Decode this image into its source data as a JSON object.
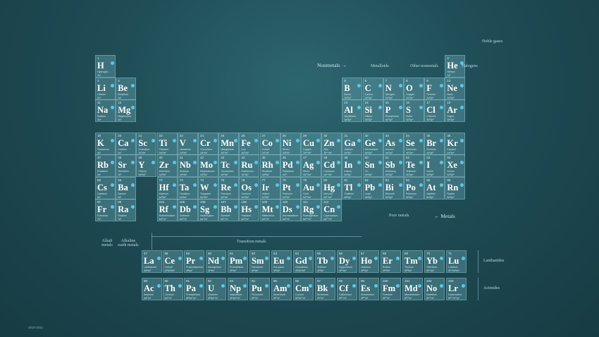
{
  "colors": {
    "background": "#1f4c55",
    "cell": "#6eafbe",
    "dot": "#5bc8e6"
  },
  "labels": {
    "noble_gases": "Noble gases",
    "nonmetals": "Nonmetals →",
    "metalloids": "Metalloids",
    "other_nonmetals": "Other nonmetals",
    "halogens": "Halogens",
    "alkali": "Alkali metals",
    "alkaline": "Alkaline earth metals",
    "transition": "Transition metals",
    "poor": "Poor metals",
    "metals": "← Metals",
    "lanthanides": "Lanthanides",
    "actinides": "Actinides"
  },
  "credit": "2010-2011",
  "elements": [
    {
      "n": "1",
      "s": "H",
      "name": "Hydrogen",
      "c": "1s¹",
      "col": 1,
      "row": 1
    },
    {
      "n": "2",
      "s": "He",
      "name": "Helium",
      "c": "1s²",
      "col": 18,
      "row": 1
    },
    {
      "n": "3",
      "s": "Li",
      "name": "Lithium",
      "c": "2s¹",
      "col": 1,
      "row": 2
    },
    {
      "n": "4",
      "s": "Be",
      "name": "Beryllium",
      "c": "2s²",
      "col": 2,
      "row": 2
    },
    {
      "n": "5",
      "s": "B",
      "name": "Boron",
      "c": "2s²2p¹",
      "col": 13,
      "row": 2
    },
    {
      "n": "6",
      "s": "C",
      "name": "Carbon",
      "c": "2s²2p²",
      "col": 14,
      "row": 2
    },
    {
      "n": "7",
      "s": "N",
      "name": "Nitrogen",
      "c": "2s²2p³",
      "col": 15,
      "row": 2
    },
    {
      "n": "8",
      "s": "O",
      "name": "Oxygen",
      "c": "2s²2p⁴",
      "col": 16,
      "row": 2
    },
    {
      "n": "9",
      "s": "F",
      "name": "Fluorine",
      "c": "2s²2p⁵",
      "col": 17,
      "row": 2
    },
    {
      "n": "10",
      "s": "Ne",
      "name": "Neon",
      "c": "2s²2p⁶",
      "col": 18,
      "row": 2
    },
    {
      "n": "11",
      "s": "Na",
      "name": "Sodium",
      "c": "3s¹",
      "col": 1,
      "row": 3
    },
    {
      "n": "12",
      "s": "Mg",
      "name": "Magnesium",
      "c": "3s²",
      "col": 2,
      "row": 3
    },
    {
      "n": "13",
      "s": "Al",
      "name": "Aluminium",
      "c": "3s²3p¹",
      "col": 13,
      "row": 3
    },
    {
      "n": "14",
      "s": "Si",
      "name": "Silicon",
      "c": "3s²3p²",
      "col": 14,
      "row": 3
    },
    {
      "n": "15",
      "s": "P",
      "name": "Phosphorus",
      "c": "3s²3p³",
      "col": 15,
      "row": 3
    },
    {
      "n": "16",
      "s": "S",
      "name": "Sulfur",
      "c": "3s²3p⁴",
      "col": 16,
      "row": 3
    },
    {
      "n": "17",
      "s": "Cl",
      "name": "Chlorine",
      "c": "3s²3p⁵",
      "col": 17,
      "row": 3
    },
    {
      "n": "18",
      "s": "Ar",
      "name": "Argon",
      "c": "3s²3p⁶",
      "col": 18,
      "row": 3
    },
    {
      "n": "19",
      "s": "K",
      "name": "Potassium",
      "c": "4s¹",
      "col": 1,
      "row": 4
    },
    {
      "n": "20",
      "s": "Ca",
      "name": "Calcium",
      "c": "4s²",
      "col": 2,
      "row": 4
    },
    {
      "n": "21",
      "s": "Sc",
      "name": "Scandium",
      "c": "3d¹4s²",
      "col": 3,
      "row": 4
    },
    {
      "n": "22",
      "s": "Ti",
      "name": "Titanium",
      "c": "3d²4s²",
      "col": 4,
      "row": 4
    },
    {
      "n": "23",
      "s": "V",
      "name": "Vanadium",
      "c": "3d³4s²",
      "col": 5,
      "row": 4
    },
    {
      "n": "24",
      "s": "Cr",
      "name": "Chromium",
      "c": "3d⁵4s¹",
      "col": 6,
      "row": 4
    },
    {
      "n": "25",
      "s": "Mn",
      "name": "Manganese",
      "c": "3d⁵4s²",
      "col": 7,
      "row": 4
    },
    {
      "n": "26",
      "s": "Fe",
      "name": "Iron",
      "c": "3d⁶4s²",
      "col": 8,
      "row": 4
    },
    {
      "n": "27",
      "s": "Co",
      "name": "Cobalt",
      "c": "3d⁷4s²",
      "col": 9,
      "row": 4
    },
    {
      "n": "28",
      "s": "Ni",
      "name": "Nickel",
      "c": "3d⁸4s²",
      "col": 10,
      "row": 4
    },
    {
      "n": "29",
      "s": "Cu",
      "name": "Copper",
      "c": "3d¹⁰4s¹",
      "col": 11,
      "row": 4
    },
    {
      "n": "30",
      "s": "Zn",
      "name": "Zinc",
      "c": "3d¹⁰4s²",
      "col": 12,
      "row": 4
    },
    {
      "n": "31",
      "s": "Ga",
      "name": "Gallium",
      "c": "4s²4p¹",
      "col": 13,
      "row": 4
    },
    {
      "n": "32",
      "s": "Ge",
      "name": "Germanium",
      "c": "4s²4p²",
      "col": 14,
      "row": 4
    },
    {
      "n": "33",
      "s": "As",
      "name": "Arsenic",
      "c": "4s²4p³",
      "col": 15,
      "row": 4
    },
    {
      "n": "34",
      "s": "Se",
      "name": "Selenium",
      "c": "4s²4p⁴",
      "col": 16,
      "row": 4
    },
    {
      "n": "35",
      "s": "Br",
      "name": "Bromine",
      "c": "4s²4p⁵",
      "col": 17,
      "row": 4
    },
    {
      "n": "36",
      "s": "Kr",
      "name": "Krypton",
      "c": "4s²4p⁶",
      "col": 18,
      "row": 4
    },
    {
      "n": "37",
      "s": "Rb",
      "name": "Rubidium",
      "c": "5s¹",
      "col": 1,
      "row": 5
    },
    {
      "n": "38",
      "s": "Sr",
      "name": "Strontium",
      "c": "5s²",
      "col": 2,
      "row": 5
    },
    {
      "n": "39",
      "s": "Y",
      "name": "Yttrium",
      "c": "4d¹5s²",
      "col": 3,
      "row": 5
    },
    {
      "n": "40",
      "s": "Zr",
      "name": "Zirconium",
      "c": "4d²5s²",
      "col": 4,
      "row": 5
    },
    {
      "n": "41",
      "s": "Nb",
      "name": "Niobium",
      "c": "4d⁴5s¹",
      "col": 5,
      "row": 5
    },
    {
      "n": "42",
      "s": "Mo",
      "name": "Molybdenum",
      "c": "4d⁵5s¹",
      "col": 6,
      "row": 5
    },
    {
      "n": "43",
      "s": "Tc",
      "name": "Technetium",
      "c": "4d⁵5s²",
      "col": 7,
      "row": 5
    },
    {
      "n": "44",
      "s": "Ru",
      "name": "Ruthenium",
      "c": "4d⁷5s¹",
      "col": 8,
      "row": 5
    },
    {
      "n": "45",
      "s": "Rh",
      "name": "Rhodium",
      "c": "4d⁸5s¹",
      "col": 9,
      "row": 5
    },
    {
      "n": "46",
      "s": "Pd",
      "name": "Palladium",
      "c": "4d¹⁰",
      "col": 10,
      "row": 5
    },
    {
      "n": "47",
      "s": "Ag",
      "name": "Silver",
      "c": "4d¹⁰5s¹",
      "col": 11,
      "row": 5
    },
    {
      "n": "48",
      "s": "Cd",
      "name": "Cadmium",
      "c": "4d¹⁰5s²",
      "col": 12,
      "row": 5
    },
    {
      "n": "49",
      "s": "In",
      "name": "Indium",
      "c": "5s²5p¹",
      "col": 13,
      "row": 5
    },
    {
      "n": "50",
      "s": "Sn",
      "name": "Tin",
      "c": "5s²5p²",
      "col": 14,
      "row": 5
    },
    {
      "n": "51",
      "s": "Sb",
      "name": "Antimony",
      "c": "5s²5p³",
      "col": 15,
      "row": 5
    },
    {
      "n": "52",
      "s": "Te",
      "name": "Tellurium",
      "c": "5s²5p⁴",
      "col": 16,
      "row": 5
    },
    {
      "n": "53",
      "s": "I",
      "name": "Iodine",
      "c": "5s²5p⁵",
      "col": 17,
      "row": 5
    },
    {
      "n": "54",
      "s": "Xe",
      "name": "Xenon",
      "c": "5s²5p⁶",
      "col": 18,
      "row": 5
    },
    {
      "n": "55",
      "s": "Cs",
      "name": "Caesium",
      "c": "6s¹",
      "col": 1,
      "row": 6
    },
    {
      "n": "56",
      "s": "Ba",
      "name": "Barium",
      "c": "6s²",
      "col": 2,
      "row": 6
    },
    {
      "n": "72",
      "s": "Hf",
      "name": "Hafnium",
      "c": "5d²6s²",
      "col": 4,
      "row": 6
    },
    {
      "n": "73",
      "s": "Ta",
      "name": "Tantalum",
      "c": "5d³6s²",
      "col": 5,
      "row": 6
    },
    {
      "n": "74",
      "s": "W",
      "name": "Tungsten",
      "c": "5d⁴6s²",
      "col": 6,
      "row": 6
    },
    {
      "n": "75",
      "s": "Re",
      "name": "Rhenium",
      "c": "5d⁵6s²",
      "col": 7,
      "row": 6
    },
    {
      "n": "76",
      "s": "Os",
      "name": "Osmium",
      "c": "5d⁶6s²",
      "col": 8,
      "row": 6
    },
    {
      "n": "77",
      "s": "Ir",
      "name": "Iridium",
      "c": "5d⁷6s²",
      "col": 9,
      "row": 6
    },
    {
      "n": "78",
      "s": "Pt",
      "name": "Platinum",
      "c": "5d⁹6s¹",
      "col": 10,
      "row": 6
    },
    {
      "n": "79",
      "s": "Au",
      "name": "Gold",
      "c": "5d¹⁰6s¹",
      "col": 11,
      "row": 6
    },
    {
      "n": "80",
      "s": "Hg",
      "name": "Mercury",
      "c": "5d¹⁰6s²",
      "col": 12,
      "row": 6
    },
    {
      "n": "81",
      "s": "Tl",
      "name": "Thallium",
      "c": "6s²6p¹",
      "col": 13,
      "row": 6
    },
    {
      "n": "82",
      "s": "Pb",
      "name": "Lead",
      "c": "6s²6p²",
      "col": 14,
      "row": 6
    },
    {
      "n": "83",
      "s": "Bi",
      "name": "Bismuth",
      "c": "6s²6p³",
      "col": 15,
      "row": 6
    },
    {
      "n": "84",
      "s": "Po",
      "name": "Polonium",
      "c": "6s²6p⁴",
      "col": 16,
      "row": 6
    },
    {
      "n": "85",
      "s": "At",
      "name": "Astatine",
      "c": "6s²6p⁵",
      "col": 17,
      "row": 6
    },
    {
      "n": "86",
      "s": "Rn",
      "name": "Radon",
      "c": "6s²6p⁶",
      "col": 18,
      "row": 6
    },
    {
      "n": "87",
      "s": "Fr",
      "name": "Francium",
      "c": "7s¹",
      "col": 1,
      "row": 7
    },
    {
      "n": "88",
      "s": "Ra",
      "name": "Radium",
      "c": "7s²",
      "col": 2,
      "row": 7
    },
    {
      "n": "104",
      "s": "Rf",
      "name": "Rutherfordium",
      "c": "6d²7s²",
      "col": 4,
      "row": 7
    },
    {
      "n": "105",
      "s": "Db",
      "name": "Dubnium",
      "c": "6d³7s²",
      "col": 5,
      "row": 7
    },
    {
      "n": "106",
      "s": "Sg",
      "name": "Seaborgium",
      "c": "6d⁴7s²",
      "col": 6,
      "row": 7
    },
    {
      "n": "107",
      "s": "Bh",
      "name": "Bohrium",
      "c": "6d⁵7s²",
      "col": 7,
      "row": 7
    },
    {
      "n": "108",
      "s": "Hs",
      "name": "Hassium",
      "c": "6d⁶7s²",
      "col": 8,
      "row": 7
    },
    {
      "n": "109",
      "s": "Mt",
      "name": "Meitnerium",
      "c": "6d⁷7s²",
      "col": 9,
      "row": 7
    },
    {
      "n": "110",
      "s": "Ds",
      "name": "Darmstadtium",
      "c": "6d⁹7s¹",
      "col": 10,
      "row": 7
    },
    {
      "n": "111",
      "s": "Rg",
      "name": "Roentgenium",
      "c": "6d¹⁰7s¹",
      "col": 11,
      "row": 7
    },
    {
      "n": "112",
      "s": "Cn",
      "name": "Copernicium",
      "c": "6d¹⁰7s²",
      "col": 12,
      "row": 7
    },
    {
      "n": "57",
      "s": "La",
      "name": "Lanthanum",
      "c": "5d¹6s²",
      "col": 1,
      "row": 9
    },
    {
      "n": "58",
      "s": "Ce",
      "name": "Cerium",
      "c": "4f¹5d¹6s²",
      "col": 2,
      "row": 9
    },
    {
      "n": "59",
      "s": "Pr",
      "name": "Praseodymium",
      "c": "4f³6s²",
      "col": 3,
      "row": 9
    },
    {
      "n": "60",
      "s": "Nd",
      "name": "Neodymium",
      "c": "4f⁴6s²",
      "col": 4,
      "row": 9
    },
    {
      "n": "61",
      "s": "Pm",
      "name": "Promethium",
      "c": "4f⁵6s²",
      "col": 5,
      "row": 9
    },
    {
      "n": "62",
      "s": "Sm",
      "name": "Samarium",
      "c": "4f⁶6s²",
      "col": 6,
      "row": 9
    },
    {
      "n": "63",
      "s": "Eu",
      "name": "Europium",
      "c": "4f⁷6s²",
      "col": 7,
      "row": 9
    },
    {
      "n": "64",
      "s": "Gd",
      "name": "Gadolinium",
      "c": "4f⁷5d¹6s²",
      "col": 8,
      "row": 9
    },
    {
      "n": "65",
      "s": "Tb",
      "name": "Terbium",
      "c": "4f⁹6s²",
      "col": 9,
      "row": 9
    },
    {
      "n": "66",
      "s": "Dy",
      "name": "Dysprosium",
      "c": "4f¹⁰6s²",
      "col": 10,
      "row": 9
    },
    {
      "n": "67",
      "s": "Ho",
      "name": "Holmium",
      "c": "4f¹¹6s²",
      "col": 11,
      "row": 9
    },
    {
      "n": "68",
      "s": "Er",
      "name": "Erbium",
      "c": "4f¹²6s²",
      "col": 12,
      "row": 9
    },
    {
      "n": "69",
      "s": "Tm",
      "name": "Thulium",
      "c": "4f¹³6s²",
      "col": 13,
      "row": 9
    },
    {
      "n": "70",
      "s": "Yb",
      "name": "Ytterbium",
      "c": "4f¹⁴6s²",
      "col": 14,
      "row": 9
    },
    {
      "n": "71",
      "s": "Lu",
      "name": "Lutetium",
      "c": "4f¹⁴5d¹6s²",
      "col": 15,
      "row": 9
    },
    {
      "n": "89",
      "s": "Ac",
      "name": "Actinium",
      "c": "6d¹7s²",
      "col": 1,
      "row": 10
    },
    {
      "n": "90",
      "s": "Th",
      "name": "Thorium",
      "c": "6d²7s²",
      "col": 2,
      "row": 10
    },
    {
      "n": "91",
      "s": "Pa",
      "name": "Protactinium",
      "c": "5f²6d¹7s²",
      "col": 3,
      "row": 10
    },
    {
      "n": "92",
      "s": "U",
      "name": "Uranium",
      "c": "5f³6d¹7s²",
      "col": 4,
      "row": 10
    },
    {
      "n": "93",
      "s": "Np",
      "name": "Neptunium",
      "c": "5f⁴6d¹7s²",
      "col": 5,
      "row": 10
    },
    {
      "n": "94",
      "s": "Pu",
      "name": "Plutonium",
      "c": "5f⁶7s²",
      "col": 6,
      "row": 10
    },
    {
      "n": "95",
      "s": "Am",
      "name": "Americium",
      "c": "5f⁷7s²",
      "col": 7,
      "row": 10
    },
    {
      "n": "96",
      "s": "Cm",
      "name": "Curium",
      "c": "5f⁷6d¹7s²",
      "col": 8,
      "row": 10
    },
    {
      "n": "97",
      "s": "Bk",
      "name": "Berkelium",
      "c": "5f⁹7s²",
      "col": 9,
      "row": 10
    },
    {
      "n": "98",
      "s": "Cf",
      "name": "Californium",
      "c": "5f¹⁰7s²",
      "col": 10,
      "row": 10
    },
    {
      "n": "99",
      "s": "Es",
      "name": "Einsteinium",
      "c": "5f¹¹7s²",
      "col": 11,
      "row": 10
    },
    {
      "n": "100",
      "s": "Fm",
      "name": "Fermium",
      "c": "5f¹²7s²",
      "col": 12,
      "row": 10
    },
    {
      "n": "101",
      "s": "Md",
      "name": "Mendelevium",
      "c": "5f¹³7s²",
      "col": 13,
      "row": 10
    },
    {
      "n": "102",
      "s": "No",
      "name": "Nobelium",
      "c": "5f¹⁴7s²",
      "col": 14,
      "row": 10
    },
    {
      "n": "103",
      "s": "Lr",
      "name": "Lawrencium",
      "c": "5f¹⁴7s²7p¹",
      "col": 15,
      "row": 10
    }
  ]
}
